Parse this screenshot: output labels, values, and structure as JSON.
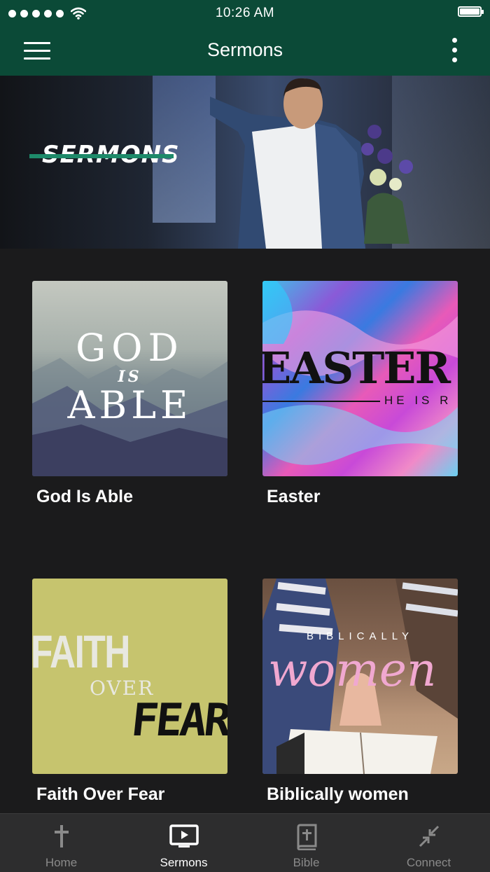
{
  "status": {
    "time": "10:26 AM",
    "signal_dots": 5,
    "battery_level": 1.0
  },
  "nav": {
    "title": "Sermons"
  },
  "hero": {
    "logo_text": "SERMONS"
  },
  "sermons": [
    {
      "title": "God Is Able",
      "art_lines": [
        "GOD",
        "IS",
        "ABLE"
      ]
    },
    {
      "title": "Easter",
      "art_lines": [
        "EASTER",
        "HE IS R"
      ]
    },
    {
      "title": "Faith Over Fear",
      "art_lines": [
        "FAITH",
        "OVER",
        "FEAR"
      ]
    },
    {
      "title": "Biblically women",
      "art_lines": [
        "BIBLICALLY",
        "women"
      ]
    }
  ],
  "tabs": [
    {
      "label": "Home",
      "icon": "cross-icon",
      "active": false
    },
    {
      "label": "Sermons",
      "icon": "tv-play-icon",
      "active": true
    },
    {
      "label": "Bible",
      "icon": "bible-icon",
      "active": false
    },
    {
      "label": "Connect",
      "icon": "connect-arrows-icon",
      "active": false
    }
  ],
  "colors": {
    "primary": "#0b4a37",
    "background": "#1b1b1c",
    "tab_bar": "#2d2d2e",
    "accent_line": "#1e8a6a"
  }
}
